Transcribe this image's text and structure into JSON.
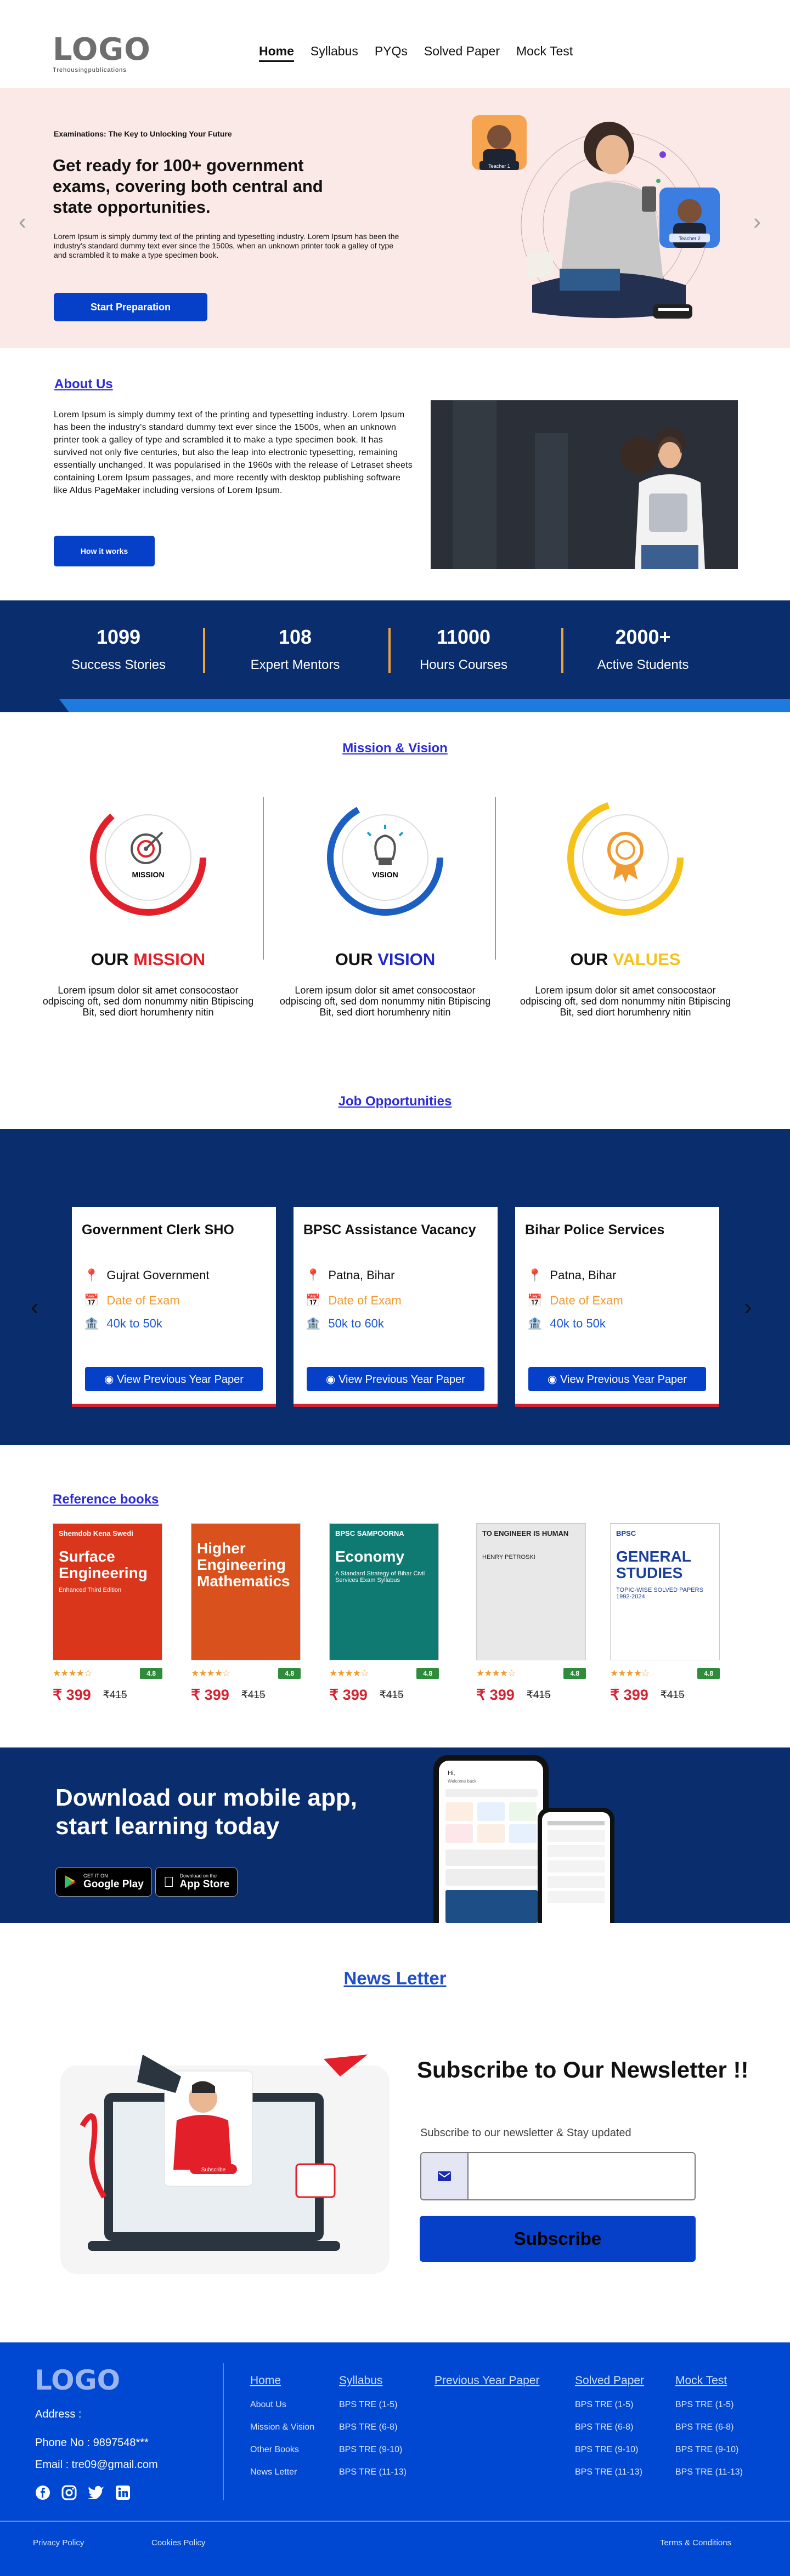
{
  "header": {
    "logo_text": "LOGO",
    "logo_sub": "Trehousingpublications",
    "nav": [
      "Home",
      "Syllabus",
      "PYQs",
      "Solved Paper",
      "Mock Test"
    ]
  },
  "hero": {
    "eyebrow": "Examinations: The Key to Unlocking Your Future",
    "title": "Get ready for 100+ government exams, covering both central and state opportunities.",
    "description": "Lorem Ipsum is simply dummy text of the printing and typesetting industry. Lorem Ipsum has been the industry's standard dummy text ever since the 1500s, when an unknown printer took a galley of type and scrambled it to make a type specimen book.",
    "button": "Start Preparation",
    "badge_left": "Teacher 1",
    "badge_right": "Teacher 2"
  },
  "about": {
    "title": "About Us",
    "text": "Lorem Ipsum is simply dummy text of the printing and typesetting industry. Lorem Ipsum has been the industry's standard dummy text ever since the 1500s, when an unknown printer took a galley of type and scrambled it to make a type specimen book. It has survived not only five centuries, but also the leap into electronic typesetting, remaining essentially unchanged. It was popularised in the 1960s with the release of Letraset sheets containing Lorem Ipsum passages, and more recently with desktop publishing software like Aldus PageMaker including versions of Lorem Ipsum.",
    "button": "How it works"
  },
  "stats": [
    {
      "num": "1099",
      "label": "Success Stories"
    },
    {
      "num": "108",
      "label": "Expert Mentors"
    },
    {
      "num": "11000",
      "label": "Hours Courses"
    },
    {
      "num": "2000+",
      "label": "Active Students"
    }
  ],
  "mission_vision": {
    "title": "Mission & Vision",
    "items": [
      {
        "icon_label": "MISSION",
        "prefix": "OUR",
        "word": "MISSION",
        "color": "#e3202a",
        "text": "Lorem ipsum dolor sit amet consocostaor odpiscing oft, sed dom nonummy nitin Btipiscing Bit, sed diort horumhenry nitin"
      },
      {
        "icon_label": "VISION",
        "prefix": "OUR",
        "word": "VISION",
        "color": "#1f28c9",
        "text": "Lorem ipsum dolor sit amet consocostaor odpiscing oft, sed dom nonummy nitin Btipiscing Bit, sed diort horumhenry nitin"
      },
      {
        "icon_label": "",
        "prefix": "OUR",
        "word": "VALUES",
        "color": "#f6c21a",
        "text": "Lorem ipsum dolor sit amet consocostaor odpiscing oft, sed dom nonummy nitin Btipiscing Bit, sed diort horumhenry nitin"
      }
    ]
  },
  "jobs": {
    "title": "Job Opportunities",
    "cards": [
      {
        "title": "Government Clerk SHO",
        "location": "Gujrat Government",
        "date_label": "Date of Exam",
        "salary": "40k to 50k",
        "button": "View Previous Year Paper"
      },
      {
        "title": "BPSC Assistance Vacancy",
        "location": "Patna, Bihar",
        "date_label": "Date of Exam",
        "salary": "50k to 60k",
        "button": "View Previous Year Paper"
      },
      {
        "title": "Bihar Police Services",
        "location": "Patna, Bihar",
        "date_label": "Date of Exam",
        "salary": "40k to 50k",
        "button": "View Previous Year Paper"
      }
    ]
  },
  "books": {
    "title": "Reference books",
    "items": [
      {
        "cover_top": "Shemdob Kena Swedi",
        "cover_title": "Surface Engineering",
        "cover_sub": "Enhanced Third Edition",
        "bg": "#d9361c",
        "fg": "#fff",
        "rating": "4.8",
        "stars": 4,
        "price": "₹ 399",
        "mrp": "₹415"
      },
      {
        "cover_top": "",
        "cover_title": "Higher Engineering Mathematics",
        "cover_sub": "",
        "bg": "#d9511c",
        "fg": "#fff",
        "rating": "4.8",
        "stars": 4,
        "price": "₹ 399",
        "mrp": "₹415"
      },
      {
        "cover_top": "BPSC SAMPOORNA",
        "cover_title": "Economy",
        "cover_sub": "A Standard Strategy of Bihar Civil Services Exam Syllabus",
        "bg": "#0f7a72",
        "fg": "#fff",
        "rating": "4.8",
        "stars": 4,
        "price": "₹ 399",
        "mrp": "₹415"
      },
      {
        "cover_top": "TO ENGINEER IS HUMAN",
        "cover_title": "",
        "cover_sub": "HENRY PETROSKI",
        "bg": "#e8e8e8",
        "fg": "#222",
        "rating": "4.8",
        "stars": 4,
        "price": "₹ 399",
        "mrp": "₹415"
      },
      {
        "cover_top": "BPSC",
        "cover_title": "GENERAL STUDIES",
        "cover_sub": "TOPIC-WISE SOLVED PAPERS 1992-2024",
        "bg": "#fff",
        "fg": "#1b3f9c",
        "rating": "4.8",
        "stars": 4,
        "price": "₹ 399",
        "mrp": "₹415"
      }
    ]
  },
  "app": {
    "title": "Download our mobile app, start learning today",
    "google_small": "GET IT ON",
    "google_big": "Google Play",
    "apple_small": "Download on the",
    "apple_big": "App Store",
    "phone_greeting": "Hi,",
    "phone_sub": "Welcome back"
  },
  "newsletter": {
    "title": "News Letter",
    "heading": "Subscribe to Our Newsletter !!",
    "subtitle": "Subscribe to our newsletter & Stay updated",
    "placeholder": "",
    "button": "Subscribe",
    "art_button": "Subscribe"
  },
  "footer": {
    "logo": "LOGO",
    "address": "Address :",
    "phone": "Phone No : 9897548***",
    "email": "Email : tre09@gmail.com",
    "columns": [
      {
        "title": "Home",
        "links": [
          "About Us",
          "Mission & Vision",
          "Other Books",
          "News Letter"
        ]
      },
      {
        "title": "Syllabus",
        "links": [
          "BPS TRE (1-5)",
          "BPS TRE (6-8)",
          "BPS TRE (9-10)",
          "BPS TRE (11-13)"
        ]
      },
      {
        "title": "Previous Year Paper",
        "links": []
      },
      {
        "title": "Solved Paper",
        "links": [
          "BPS TRE (1-5)",
          "BPS TRE (6-8)",
          "BPS TRE (9-10)",
          "BPS TRE (11-13)"
        ]
      },
      {
        "title": "Mock Test",
        "links": [
          "BPS TRE (1-5)",
          "BPS TRE (6-8)",
          "BPS TRE (9-10)",
          "BPS TRE (11-13)"
        ]
      }
    ],
    "privacy": "Privacy Policy",
    "cookies": "Cookies Policy",
    "terms": "Terms & Conditions"
  }
}
